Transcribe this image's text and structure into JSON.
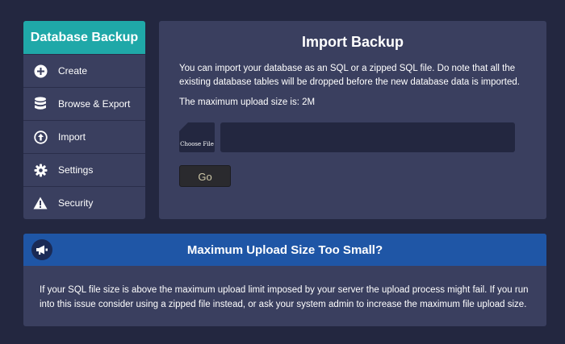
{
  "sidebar": {
    "title": "Database Backup",
    "accent": "#1fa8a8",
    "items": [
      {
        "label": "Create",
        "icon": "plus-circle-icon"
      },
      {
        "label": "Browse & Export",
        "icon": "database-icon"
      },
      {
        "label": "Import",
        "icon": "upload-circle-icon"
      },
      {
        "label": "Settings",
        "icon": "gear-icon"
      },
      {
        "label": "Security",
        "icon": "warning-icon"
      }
    ]
  },
  "main": {
    "title": "Import Backup",
    "description": "You can import your database as an SQL or a zipped SQL file. Do note that all the existing database tables will be dropped before the new database data is imported.",
    "max_upload": "The maximum upload size is: 2M",
    "file_button": "Choose File",
    "file_value": "",
    "go_label": "Go"
  },
  "notice": {
    "title": "Maximum Upload Size Too Small?",
    "icon": "megaphone-icon",
    "body": "If your SQL file size is above the maximum upload limit imposed by your server the upload process might fail. If you run into this issue consider using a zipped file instead, or ask your system admin to increase the maximum file upload size.",
    "accent": "#1f56a6"
  }
}
